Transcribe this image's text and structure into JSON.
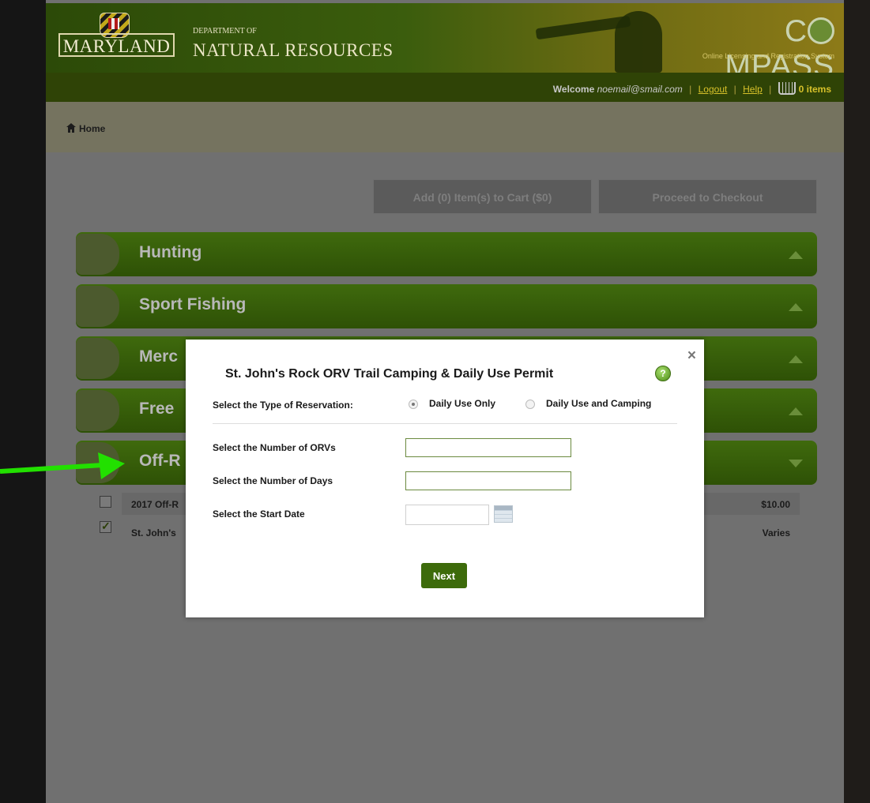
{
  "header": {
    "state_logo": "MARYLAND",
    "dept_small": "DEPARTMENT OF",
    "dept_big": "NATURAL RESOURCES",
    "brand_left": "C",
    "brand_right": "MPASS",
    "brand_sub": "Online Licensing and Registration System"
  },
  "account": {
    "welcome": "Welcome",
    "email": "noemail@smail.com",
    "logout": "Logout",
    "help": "Help",
    "cart_count": "0 items"
  },
  "breadcrumb": {
    "home": "Home"
  },
  "actions": {
    "add_to_cart": "Add (0) Item(s) to Cart ($0)",
    "checkout": "Proceed to Checkout"
  },
  "categories": [
    {
      "label": "Hunting"
    },
    {
      "label": "Sport Fishing"
    },
    {
      "label": "Merc"
    },
    {
      "label": "Free"
    },
    {
      "label": "Off-R"
    }
  ],
  "items": [
    {
      "name": "2017 Off-R",
      "price": "$10.00",
      "checked": false
    },
    {
      "name": "St. John's",
      "price": "Varies",
      "checked": true
    }
  ],
  "modal": {
    "title": "St. John's Rock ORV Trail Camping & Daily Use Permit",
    "reservation_label": "Select the Type of Reservation:",
    "options": [
      "Daily Use Only",
      "Daily Use and Camping"
    ],
    "selected_option": "Daily Use Only",
    "orvs_label": "Select the Number of ORVs",
    "orvs_value": "",
    "days_label": "Select the Number of Days",
    "days_value": "",
    "start_label": "Select the Start Date",
    "start_value": "",
    "next": "Next",
    "close": "×",
    "help": "?"
  },
  "colors": {
    "accent_green": "#3d6b0b",
    "arrow_green": "#22e000",
    "link_gold": "#d7c12a"
  },
  "icons": [
    "home-icon",
    "cart-icon",
    "help-icon",
    "close-icon",
    "calendar-icon",
    "chevron-up-icon",
    "chevron-down-icon",
    "arrow-icon"
  ]
}
